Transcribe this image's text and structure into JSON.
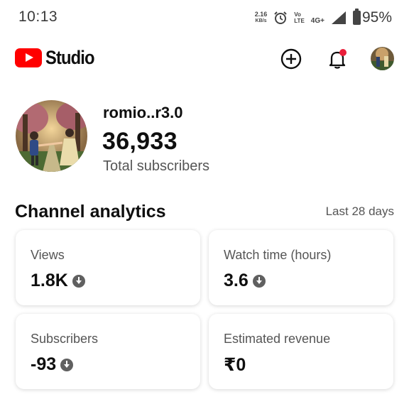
{
  "status_bar": {
    "time": "10:13",
    "net_speed_value": "2.16",
    "net_speed_unit": "KB/s",
    "volte_top": "Vo",
    "volte_bottom": "LTE",
    "network_type": "4G+",
    "battery": "95%"
  },
  "app_bar": {
    "brand": "Studio",
    "icons": [
      "youtube-logo-icon",
      "create-icon",
      "notifications-icon",
      "account-avatar"
    ],
    "notification_dot_color": "#e91e3a"
  },
  "channel": {
    "name": "romio..r3.0",
    "subscribers": "36,933",
    "subscribers_label": "Total subscribers"
  },
  "analytics": {
    "title": "Channel analytics",
    "period": "Last 28 days",
    "cards": [
      {
        "label": "Views",
        "value": "1.8K",
        "trend": "down"
      },
      {
        "label": "Watch time (hours)",
        "value": "3.6",
        "trend": "down"
      },
      {
        "label": "Subscribers",
        "value": "-93",
        "trend": "down"
      },
      {
        "label": "Estimated revenue",
        "value": "₹0",
        "trend": "none"
      }
    ]
  },
  "colors": {
    "brand_red": "#ff0000",
    "text_primary": "#0f0f0f",
    "text_secondary": "#555555",
    "trend_icon": "#606060"
  }
}
